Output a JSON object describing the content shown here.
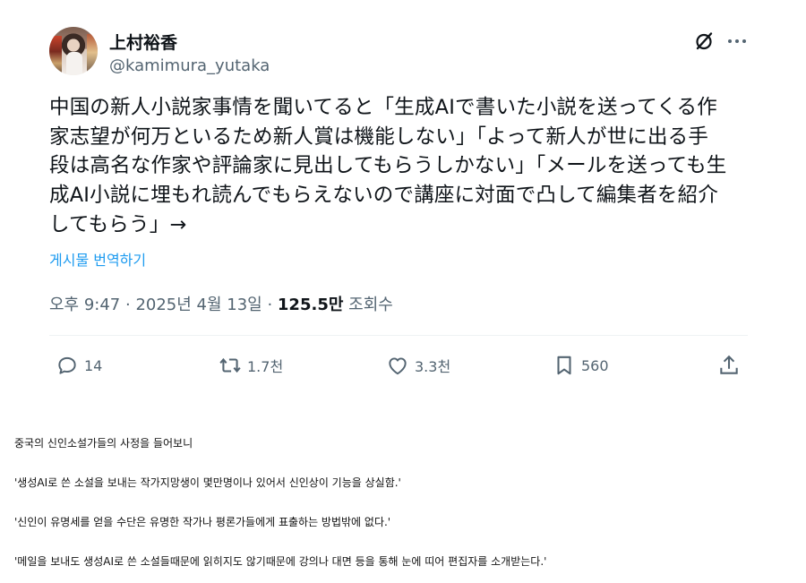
{
  "tweet": {
    "display_name": "上村裕香",
    "handle": "@kamimura_yutaka",
    "text_lines": [
      "中国の新人小説家事情を聞いてると「生成AIで書いた小説を送ってくる作",
      "家志望が何万といるため新人賞は機能しない」「よって新人が世に出る手",
      "段は高名な作家や評論家に見出してもらうしかない」「メールを送っても生",
      "成AI小説に埋もれ読んでもらえないので講座に対面で凸して編集者を紹介",
      "してもらう」→"
    ],
    "translate_label": "게시물 번역하기",
    "meta": {
      "time": "오후 9:47",
      "separator": " · ",
      "date": "2025년 4월 13일",
      "views_count": "125.5만",
      "views_label": " 조회수"
    },
    "actions": {
      "reply_count": "14",
      "repost_count": "1.7천",
      "like_count": "3.3천",
      "bookmark_count": "560"
    }
  },
  "caption": {
    "lines": [
      "중국의 신인소설가들의 사정을 들어보니",
      "'생성AI로 쓴 소설을 보내는 작가지망생이 몇만명이나 있어서 신인상이 기능을 상실함.'",
      "'신인이 유명세를 얻을 수단은 유명한 작가나 평론가들에게 표출하는 방법밖에 없다.'",
      "'메일을 보내도 생성AI로 쓴 소설들때문에 읽히지도 않기때문에 강의나 대면 등을 통해 눈에 띠어 편집자를 소개받는다.'"
    ]
  },
  "icons": {
    "grok": "grok-icon",
    "more": "more-icon",
    "reply": "reply-icon",
    "repost": "repost-icon",
    "like": "heart-icon",
    "bookmark": "bookmark-icon",
    "share": "share-icon"
  },
  "colors": {
    "text": "#0f1419",
    "secondary": "#536471",
    "link": "#1d9bf0",
    "divider": "#eff3f4"
  }
}
